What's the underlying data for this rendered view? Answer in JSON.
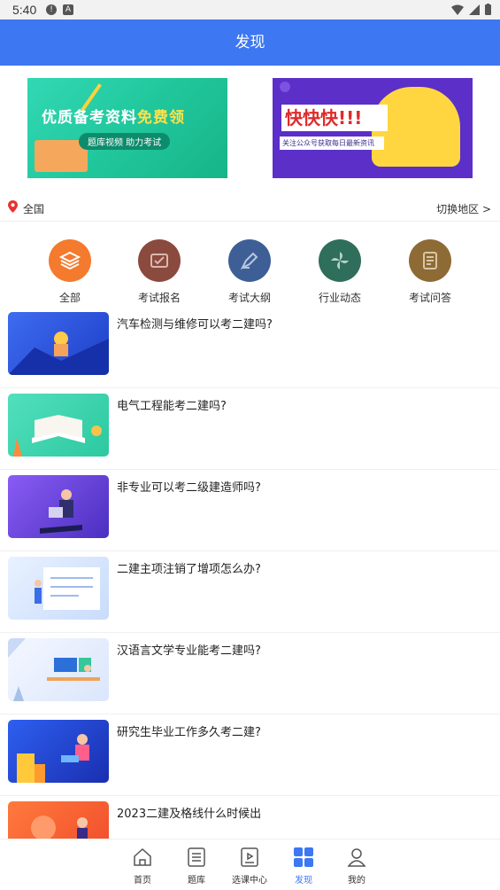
{
  "status_bar": {
    "time": "5:40"
  },
  "header": {
    "title": "发现"
  },
  "banners": [
    {
      "title_part1": "优质备考资料",
      "title_part2": "免费领",
      "subtitle": "题库视频 助力考试"
    },
    {
      "title": "快快快!!!",
      "subtitle": "关注公众号获取每日最新资讯"
    }
  ],
  "location": {
    "current": "全国",
    "switch_label": "切换地区 >"
  },
  "categories": [
    {
      "label": "全部",
      "color": "#f47a2e"
    },
    {
      "label": "考试报名",
      "color": "#8b4a3e"
    },
    {
      "label": "考试大纲",
      "color": "#3e5f96"
    },
    {
      "label": "行业动态",
      "color": "#2f6e5a"
    },
    {
      "label": "考试问答",
      "color": "#8e6b35"
    }
  ],
  "articles": [
    {
      "title": "汽车检测与维修可以考二建吗?"
    },
    {
      "title": "电气工程能考二建吗?"
    },
    {
      "title": "非专业可以考二级建造师吗?"
    },
    {
      "title": "二建主项注销了增项怎么办?"
    },
    {
      "title": "汉语言文学专业能考二建吗?"
    },
    {
      "title": "研究生毕业工作多久考二建?"
    },
    {
      "title": "2023二建及格线什么时候出"
    }
  ],
  "tabbar": [
    {
      "label": "首页",
      "icon": "home-icon"
    },
    {
      "label": "题库",
      "icon": "question-bank-icon"
    },
    {
      "label": "选课中心",
      "icon": "course-center-icon"
    },
    {
      "label": "发现",
      "icon": "discover-icon",
      "active": true
    },
    {
      "label": "我的",
      "icon": "profile-icon"
    }
  ]
}
